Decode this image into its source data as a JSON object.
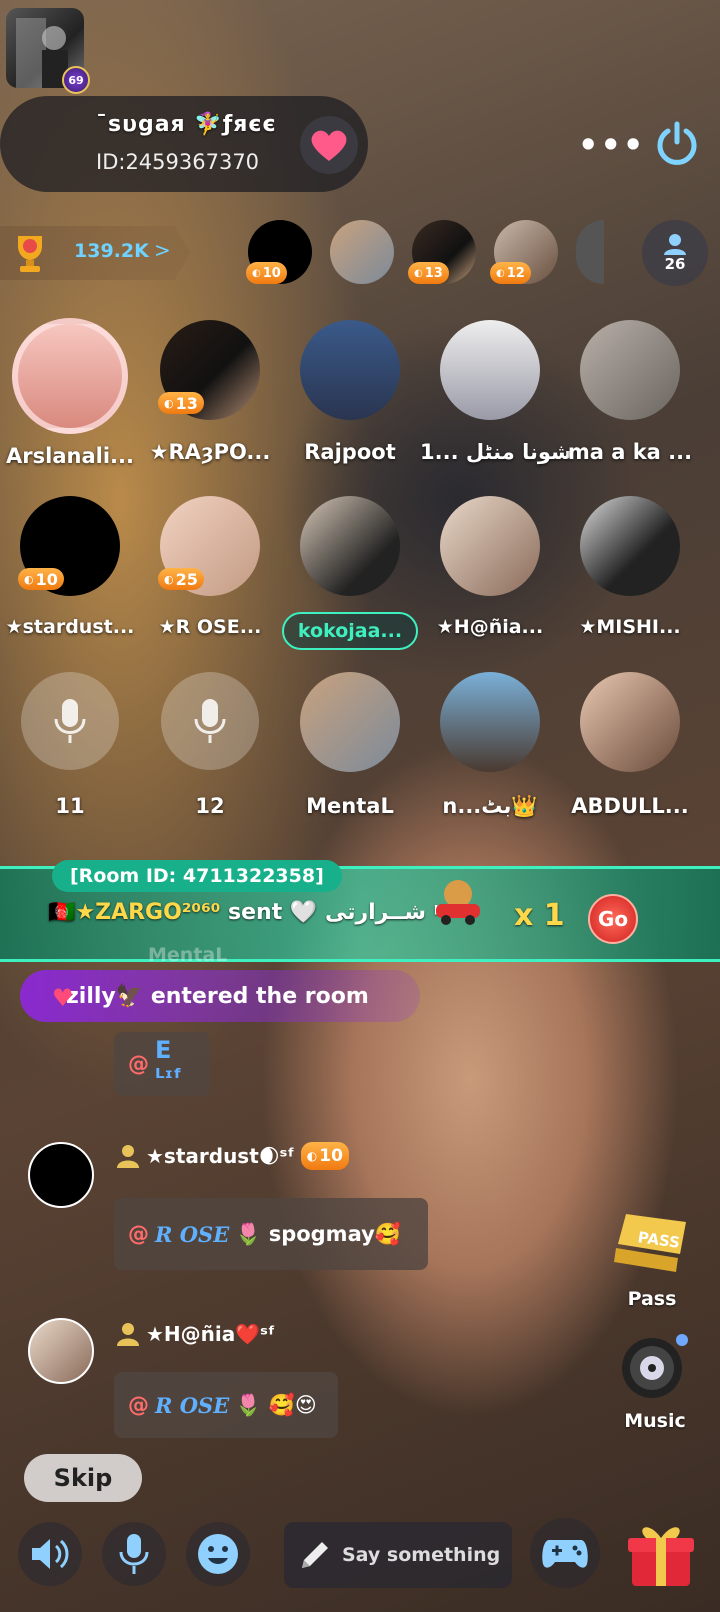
{
  "header": {
    "host_name": "ˉsυgaя 🧚‍♀️ƒяєє",
    "host_id": "ID:2459367370",
    "host_level": "69"
  },
  "ranking": {
    "value": "139.2K",
    "arrow": ">",
    "viewers": [
      {
        "badge": "10"
      },
      {
        "badge": ""
      },
      {
        "badge": "13"
      },
      {
        "badge": "12"
      }
    ],
    "viewer_count": "26"
  },
  "seats": [
    {
      "name": "Arslanali...",
      "badge": ""
    },
    {
      "name": "★RAȝPO...",
      "badge": "13"
    },
    {
      "name": "Rajpoot",
      "badge": ""
    },
    {
      "name": "شونا منٹل ...1",
      "badge": ""
    },
    {
      "name": "ma a ka ...",
      "badge": ""
    },
    {
      "name": "★stardust...",
      "badge": "10"
    },
    {
      "name": "★R OSE...",
      "badge": "25"
    },
    {
      "name": "kokojaa...",
      "badge": ""
    },
    {
      "name": "★H@ñia...",
      "badge": ""
    },
    {
      "name": "★MISHI...",
      "badge": ""
    },
    {
      "name": "11",
      "badge": ""
    },
    {
      "name": "12",
      "badge": ""
    },
    {
      "name": "MentaL",
      "badge": ""
    },
    {
      "name": "n...بٹ👑",
      "badge": ""
    },
    {
      "name": "ABDULL...",
      "badge": ""
    }
  ],
  "gift_banner": {
    "room_id": "[Room ID: 4711322358]",
    "sender": "🇦🇫★ZARGO²⁰⁶⁰",
    "sent_word": "sent 🤍",
    "receiver": "شــرارتی ᵖʷ",
    "count": "x 1",
    "go": "Go",
    "below_name": "MentaL"
  },
  "entered": {
    "text": "zilly🦅  entered the room"
  },
  "chat": {
    "msg1": {
      "mention": "@",
      "text": "E ᴸᶦᶠ"
    },
    "user2": {
      "name": "★stardust🌒ˢᶠ",
      "badge": "10"
    },
    "msg2": {
      "mention": "@",
      "rose": "R OSE",
      "text": "🌷 spogmay🥰"
    },
    "user3": {
      "name": "★H@ñia❤️ˢᶠ"
    },
    "msg3": {
      "mention": "@",
      "rose": "R OSE",
      "text": "🌷 🥰😍"
    }
  },
  "side": {
    "pass_label": "Pass",
    "pass_badge": "PASS",
    "music_label": "Music"
  },
  "bottom": {
    "skip": "Skip",
    "placeholder": "Say something"
  },
  "colors": {
    "accent_teal": "#17b08a",
    "purple": "#8a2ad0",
    "rank_blue": "#6fd2ff",
    "badge_orange": "#f07a10"
  }
}
